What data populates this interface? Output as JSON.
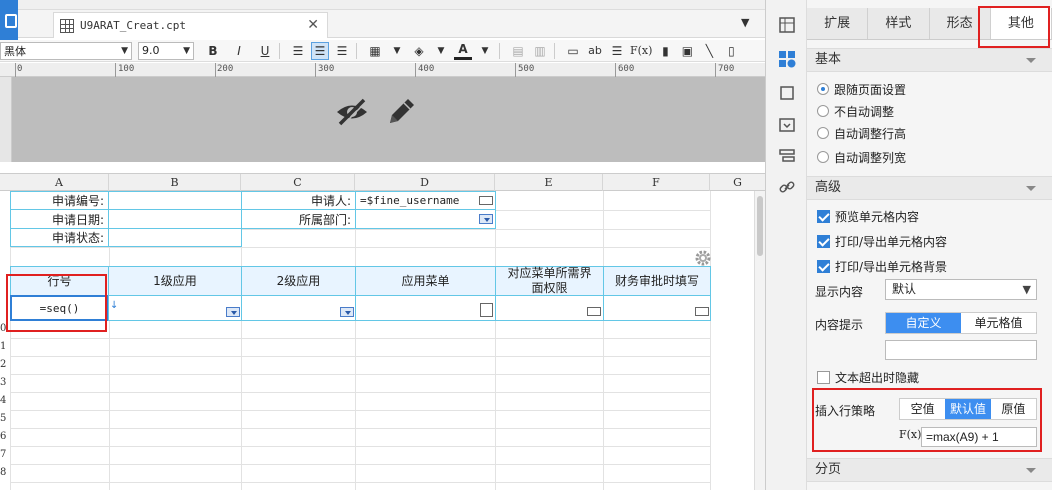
{
  "tab": {
    "filename": "U9ARAT_Creat.cpt"
  },
  "format_bar": {
    "font": "黑体",
    "size": "9.0",
    "bold": "B",
    "italic": "I",
    "underline": "U"
  },
  "ruler": {
    "marks": [
      "0",
      "100",
      "200",
      "300",
      "400",
      "500",
      "600",
      "700"
    ]
  },
  "columns": [
    "A",
    "B",
    "C",
    "D",
    "E",
    "F",
    "G"
  ],
  "rows": [
    "0",
    "1",
    "2",
    "3",
    "4",
    "5",
    "6",
    "7",
    "8"
  ],
  "cells": {
    "a1": "申请编号:",
    "a2": "申请日期:",
    "a3": "申请状态:",
    "c1": "申请人:",
    "c2": "所属部门:",
    "d1": "=$fine_username",
    "h_a": "行号",
    "h_b": "1级应用",
    "h_c": "2级应用",
    "h_d": "应用菜单",
    "h_e": "对应菜单所需界面权限",
    "h_f": "财务审批时填写",
    "seq": "=seq()"
  },
  "panel": {
    "tabs": [
      "扩展",
      "样式",
      "形态",
      "其他"
    ],
    "active_tab": "其他",
    "sections": {
      "basic": "基本",
      "advanced": "高级",
      "paging": "分页"
    },
    "basic_options": [
      "跟随页面设置",
      "不自动调整",
      "自动调整行高",
      "自动调整列宽"
    ],
    "basic_selected": "跟随页面设置",
    "advanced_checks": [
      "预览单元格内容",
      "打印/导出单元格内容",
      "打印/导出单元格背景"
    ],
    "display_content_label": "显示内容",
    "display_content_value": "默认",
    "tooltip_label": "内容提示",
    "tooltip_options": [
      "自定义",
      "单元格值"
    ],
    "tooltip_selected": "自定义",
    "overflow_hide": "文本超出时隐藏",
    "insert_policy_label": "插入行策略",
    "insert_policy_options": [
      "空值",
      "默认值",
      "原值"
    ],
    "insert_policy_selected": "默认值",
    "formula_prefix": "F(x)",
    "formula_value": "=max(A9) + 1"
  },
  "colors": {
    "accent": "#3d8ef0",
    "highlight_border": "#e02020",
    "cell_border": "#63c7e6"
  }
}
